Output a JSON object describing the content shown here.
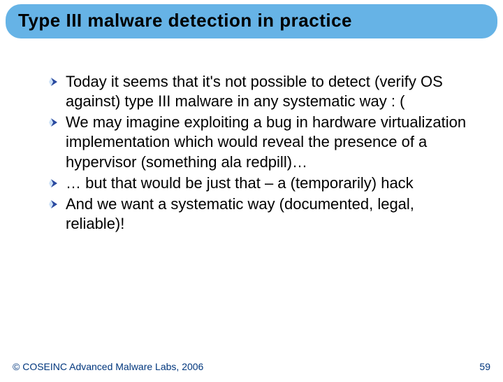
{
  "title": "Type III malware detection in practice",
  "bullets": [
    "Today it seems that it's not possible to detect (verify OS against) type III malware in any systematic way : (",
    "We may imagine exploiting a bug in hardware virtualization implementation which would reveal the presence of a hypervisor (something ala redpill)…",
    "… but that would be just that – a (temporarily) hack",
    "And we want a systematic way (documented, legal, reliable)!"
  ],
  "footer": {
    "copyright": "© COSEINC Advanced Malware Labs, 2006",
    "page": "59"
  }
}
